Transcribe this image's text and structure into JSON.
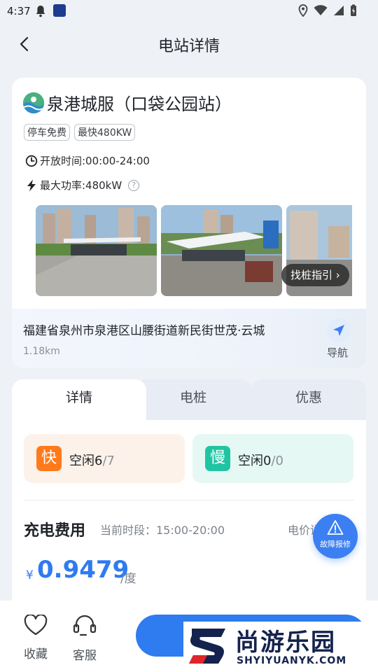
{
  "status_bar": {
    "time": "4:37"
  },
  "header": {
    "title": "电站详情"
  },
  "station": {
    "name": "泉港城服（口袋公园站）",
    "tags": [
      "停车免费",
      "最快480KW"
    ],
    "hours": "开放时间:00:00-24:00",
    "max_power": "最大功率:480kW",
    "guide_label": "找桩指引 ›",
    "address": "福建省泉州市泉港区山腰街道新民街世茂·云城",
    "distance": "1.18km",
    "nav_label": "导航"
  },
  "tabs": [
    {
      "label": "详情"
    },
    {
      "label": "电桩"
    },
    {
      "label": "优惠"
    }
  ],
  "availability": {
    "fast": {
      "badge": "快",
      "label": "空闲6",
      "total": "/7"
    },
    "slow": {
      "badge": "慢",
      "label": "空闲0",
      "total": "/0"
    }
  },
  "fee": {
    "title": "充电费用",
    "period": "当前时段：15:00-20:00",
    "price_label": "电价说",
    "currency": "¥",
    "price": "0.9479",
    "unit": "/度"
  },
  "report": {
    "label": "故障报修"
  },
  "bottom": {
    "favorite": "收藏",
    "service": "客服"
  },
  "watermark": {
    "text": "尚游乐园",
    "url": "SHYIYUANYK.COM"
  },
  "colors": {
    "accent": "#2f7bf0",
    "fast": "#ff7a1a",
    "slow": "#21c4a2"
  }
}
